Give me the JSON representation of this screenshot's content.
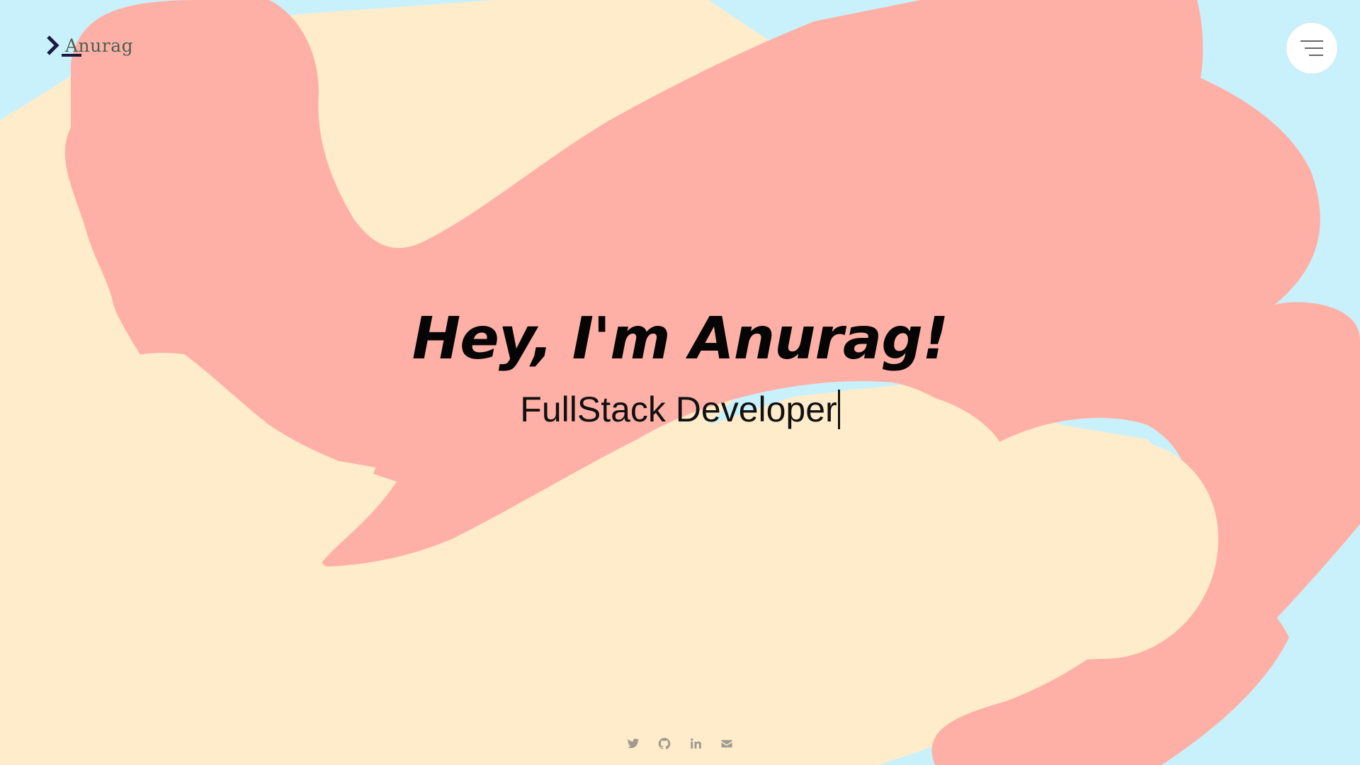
{
  "header": {
    "logo_text": "Anurag",
    "logo_icon": "terminal-prompt-icon",
    "menu_icon": "hamburger-menu-icon"
  },
  "hero": {
    "title": "Hey, I'm Anurag!",
    "subtitle": "FullStack Developer"
  },
  "social": {
    "icons": [
      "twitter-icon",
      "github-icon",
      "linkedin-icon",
      "email-icon"
    ]
  },
  "colors": {
    "sky": "#c9f1fb",
    "cream": "#ffeccb",
    "salmon": "#ffb0a6",
    "logo_mark": "#1b1a3f",
    "logo_text": "#4b5f51",
    "social_icon": "#a09a90"
  }
}
